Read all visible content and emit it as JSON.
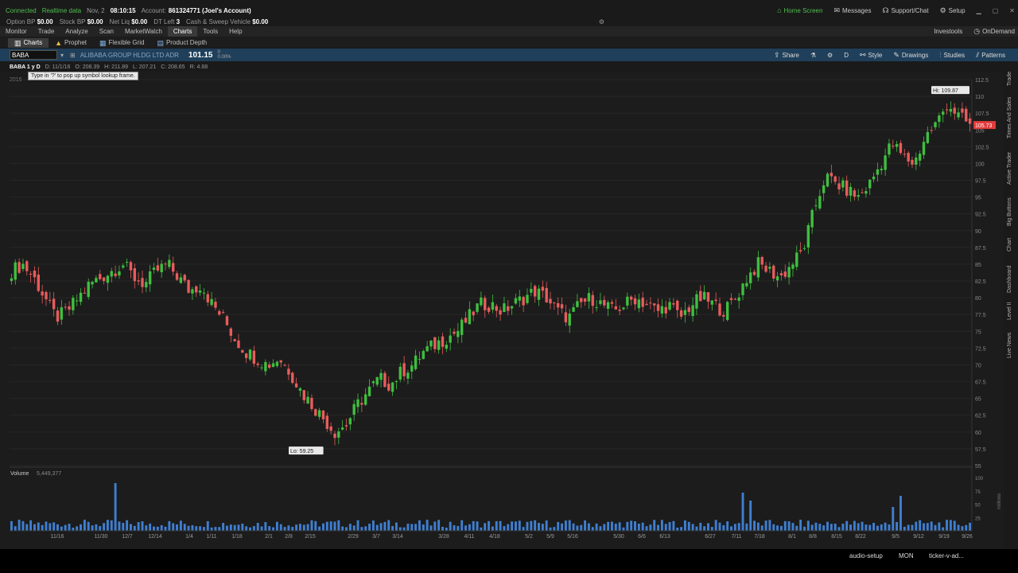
{
  "status": {
    "connected": "Connected",
    "realtime": "Realtime data",
    "date": "Nov, 2",
    "time": "08:10:15",
    "account_label": "Account:",
    "account_value": "861324771 (Joel's Account)"
  },
  "topright": {
    "home": "Home Screen",
    "messages": "Messages",
    "support": "Support/Chat",
    "setup": "Setup"
  },
  "balances": [
    {
      "label": "Option BP",
      "value": "$0.00"
    },
    {
      "label": "Stock BP",
      "value": "$0.00"
    },
    {
      "label": "Net Liq",
      "value": "$0.00"
    },
    {
      "label": "DT Left",
      "value": "3"
    },
    {
      "label": "Cash & Sweep Vehicle",
      "value": "$0.00"
    }
  ],
  "menu": [
    "Monitor",
    "Trade",
    "Analyze",
    "Scan",
    "MarketWatch",
    "Charts",
    "Tools",
    "Help"
  ],
  "menu_active": "Charts",
  "menu_right": {
    "investools": "Investools",
    "ondemand": "OnDemand"
  },
  "subtabs": [
    "Charts",
    "Prophet",
    "Flexible Grid",
    "Product Depth"
  ],
  "symbol": {
    "input": "BABA",
    "name": "ALIBABA GROUP HLDG LTD ADR",
    "price": "101.15",
    "change": "0",
    "change_pct": "0.00%"
  },
  "chart_tools": {
    "share": "Share",
    "d": "D",
    "style": "Style",
    "drawings": "Drawings",
    "studies": "Studies",
    "patterns": "Patterns"
  },
  "info": {
    "title": "BABA 1 y D",
    "d": "D: 11/1/16",
    "o": "O: 208.39",
    "h": "H: 211.89",
    "l": "L: 207.21",
    "c": "C: 208.65",
    "r": "R: 4.68"
  },
  "tooltip": "Type in '?' to pop up symbol lookup frame.",
  "right_tabs": [
    "Trade",
    "Times And Sales",
    "Active Trader",
    "Big Buttons",
    "Chart",
    "Dashboard",
    "Level II",
    "Live News"
  ],
  "bottom": {
    "audio": "audio-setup",
    "mon": "MON",
    "ticker": "ticker-v-ad..."
  },
  "chart_data": {
    "type": "candlestick",
    "symbol": "BABA",
    "price_axis": {
      "min": 55,
      "max": 112.5,
      "ticks": [
        "112.5",
        "110",
        "107.5",
        "105",
        "102.5",
        "100",
        "97.5",
        "95",
        "92.5",
        "90",
        "87.5",
        "85",
        "82.5",
        "80",
        "77.5",
        "75",
        "72.5",
        "70",
        "67.5",
        "65",
        "62.5",
        "60",
        "57.5",
        "55"
      ]
    },
    "hi_label": "Hi: 109.87",
    "lo_label": "Lo: 59.25",
    "last_tag": "105.73",
    "year_label": "2016",
    "x_labels": [
      "11/16",
      "11/30",
      "12/7",
      "12/14",
      "1/4",
      "1/11",
      "1/18",
      "2/1",
      "2/8",
      "2/15",
      "2/29",
      "3/7",
      "3/14",
      "3/28",
      "4/11",
      "4/18",
      "5/2",
      "5/9",
      "5/16",
      "5/30",
      "6/6",
      "6/13",
      "6/27",
      "7/11",
      "7/18",
      "8/1",
      "8/8",
      "8/15",
      "8/22",
      "9/5",
      "9/12",
      "9/19",
      "9/26"
    ],
    "volume_label": "Volume",
    "volume_value": "5,449,377",
    "volume_axis": {
      "ticks": [
        "100",
        "75",
        "50",
        "25"
      ],
      "unit": "millions"
    },
    "closes": [
      84,
      85,
      83,
      80,
      77,
      78,
      80,
      82,
      83,
      84,
      85,
      83,
      82,
      84,
      85,
      83,
      81,
      82,
      79,
      77,
      74,
      72,
      71,
      70,
      71,
      69,
      66,
      64,
      62,
      60,
      61,
      64,
      66,
      68,
      67,
      69,
      70,
      72,
      73,
      74,
      75,
      77,
      79,
      79,
      78,
      79,
      80,
      81,
      80,
      78,
      77,
      79,
      80,
      79,
      78,
      79,
      80,
      79,
      78,
      79,
      77,
      79,
      80,
      79,
      78,
      80,
      83,
      85,
      84,
      83,
      85,
      87,
      93,
      98,
      97,
      96,
      95,
      97,
      100,
      103,
      101,
      100,
      104,
      106,
      109,
      107,
      105.73
    ]
  }
}
